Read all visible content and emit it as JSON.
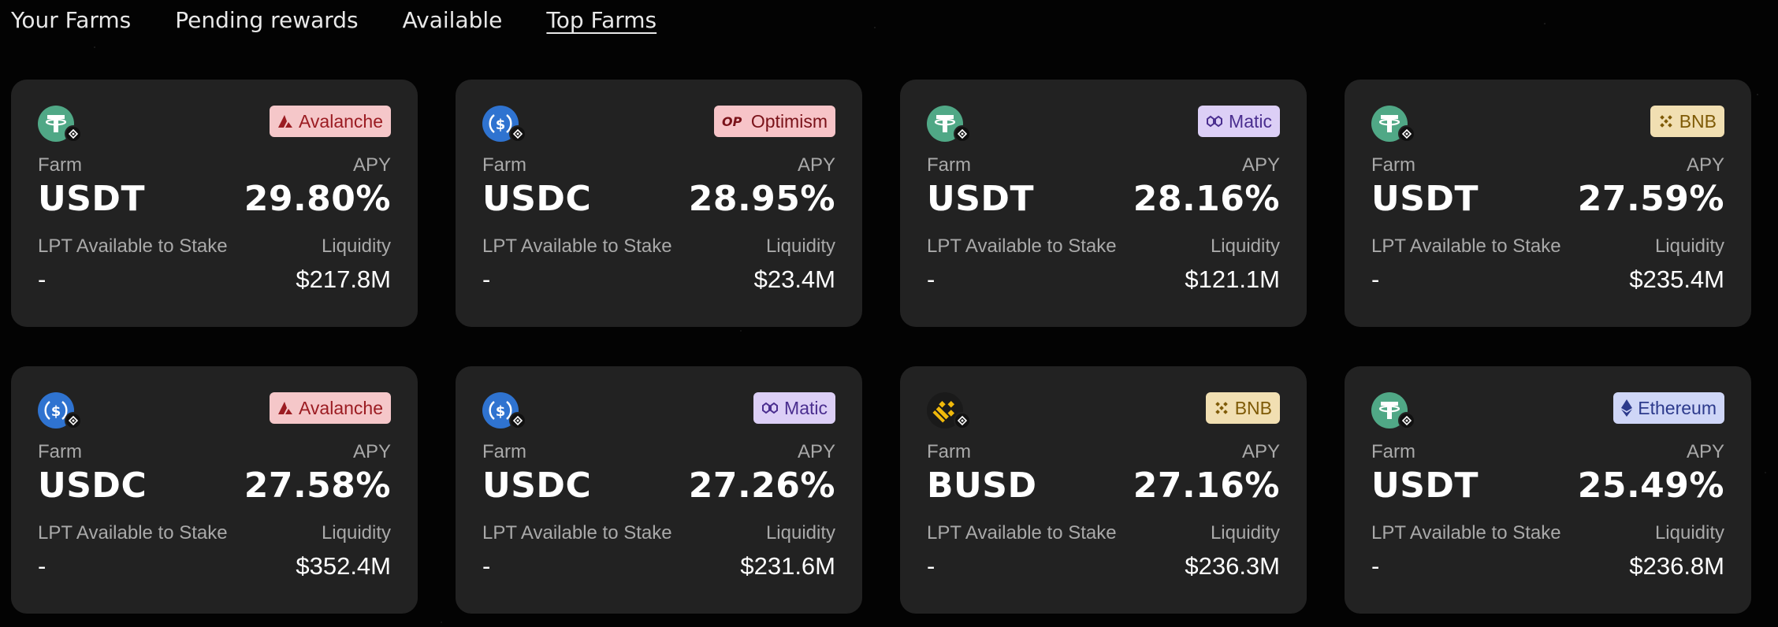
{
  "tabs": [
    {
      "label": "Your Farms",
      "active": false
    },
    {
      "label": "Pending rewards",
      "active": false
    },
    {
      "label": "Available",
      "active": false
    },
    {
      "label": "Top Farms",
      "active": true
    }
  ],
  "labels": {
    "farm": "Farm",
    "apy": "APY",
    "lpt": "LPT Available to Stake",
    "liquidity": "Liquidity"
  },
  "colors": {
    "background": "#030303",
    "card": "#222222",
    "usdt_green": "#50A886",
    "usdc_blue": "#2F73D0",
    "busd_yellow": "#F0B90B"
  },
  "chains": {
    "avalanche": {
      "label": "Avalanche",
      "icon": "avalanche-icon",
      "bg": "#F5C7C9",
      "fg": "#9B1C22"
    },
    "optimism": {
      "label": "Optimism",
      "icon": "optimism-icon",
      "bg": "#F7C4C8",
      "fg": "#7A1219"
    },
    "matic": {
      "label": "Matic",
      "icon": "polygon-icon",
      "bg": "#DCCFF6",
      "fg": "#4A2E8F"
    },
    "bnb": {
      "label": "BNB",
      "icon": "bnb-icon",
      "bg": "#F1DFB2",
      "fg": "#7E5A06"
    },
    "ethereum": {
      "label": "Ethereum",
      "icon": "ethereum-icon",
      "bg": "#CFD6F7",
      "fg": "#2C3A8C"
    }
  },
  "farms": [
    {
      "token": "USDT",
      "token_icon": "usdt-icon",
      "chain": "Avalanche",
      "apy": "29.80%",
      "lpt": "-",
      "liquidity": "$217.8M"
    },
    {
      "token": "USDC",
      "token_icon": "usdc-icon",
      "chain": "Optimism",
      "apy": "28.95%",
      "lpt": "-",
      "liquidity": "$23.4M"
    },
    {
      "token": "USDT",
      "token_icon": "usdt-icon",
      "chain": "Matic",
      "apy": "28.16%",
      "lpt": "-",
      "liquidity": "$121.1M"
    },
    {
      "token": "USDT",
      "token_icon": "usdt-icon",
      "chain": "BNB",
      "apy": "27.59%",
      "lpt": "-",
      "liquidity": "$235.4M"
    },
    {
      "token": "USDC",
      "token_icon": "usdc-icon",
      "chain": "Avalanche",
      "apy": "27.58%",
      "lpt": "-",
      "liquidity": "$352.4M"
    },
    {
      "token": "USDC",
      "token_icon": "usdc-icon",
      "chain": "Matic",
      "apy": "27.26%",
      "lpt": "-",
      "liquidity": "$231.6M"
    },
    {
      "token": "BUSD",
      "token_icon": "busd-icon",
      "chain": "BNB",
      "apy": "27.16%",
      "lpt": "-",
      "liquidity": "$236.3M"
    },
    {
      "token": "USDT",
      "token_icon": "usdt-icon",
      "chain": "Ethereum",
      "apy": "25.49%",
      "lpt": "-",
      "liquidity": "$236.8M"
    }
  ]
}
